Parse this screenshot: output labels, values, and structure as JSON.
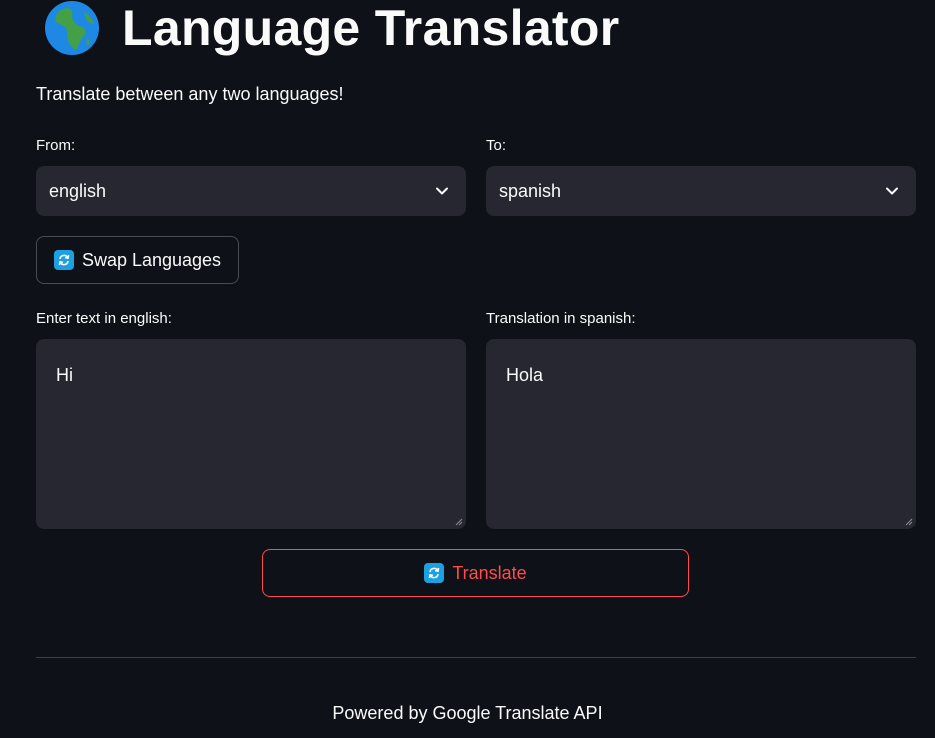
{
  "header": {
    "icon": "globe-africa-icon",
    "title": "Language Translator",
    "subtitle": "Translate between any two languages!"
  },
  "from": {
    "label": "From:",
    "selected": "english"
  },
  "to": {
    "label": "To:",
    "selected": "spanish"
  },
  "swap_button": {
    "icon": "refresh-icon",
    "label": "Swap Languages"
  },
  "input": {
    "label": "Enter text in english:",
    "value": "Hi"
  },
  "output": {
    "label": "Translation in spanish:",
    "value": "Hola"
  },
  "translate_button": {
    "icon": "refresh-icon",
    "label": "Translate"
  },
  "footer": {
    "text": "Powered by Google Translate API"
  },
  "colors": {
    "background": "#0e1117",
    "widget": "#262730",
    "accent": "#ff4b4b",
    "text": "#fafafa"
  }
}
